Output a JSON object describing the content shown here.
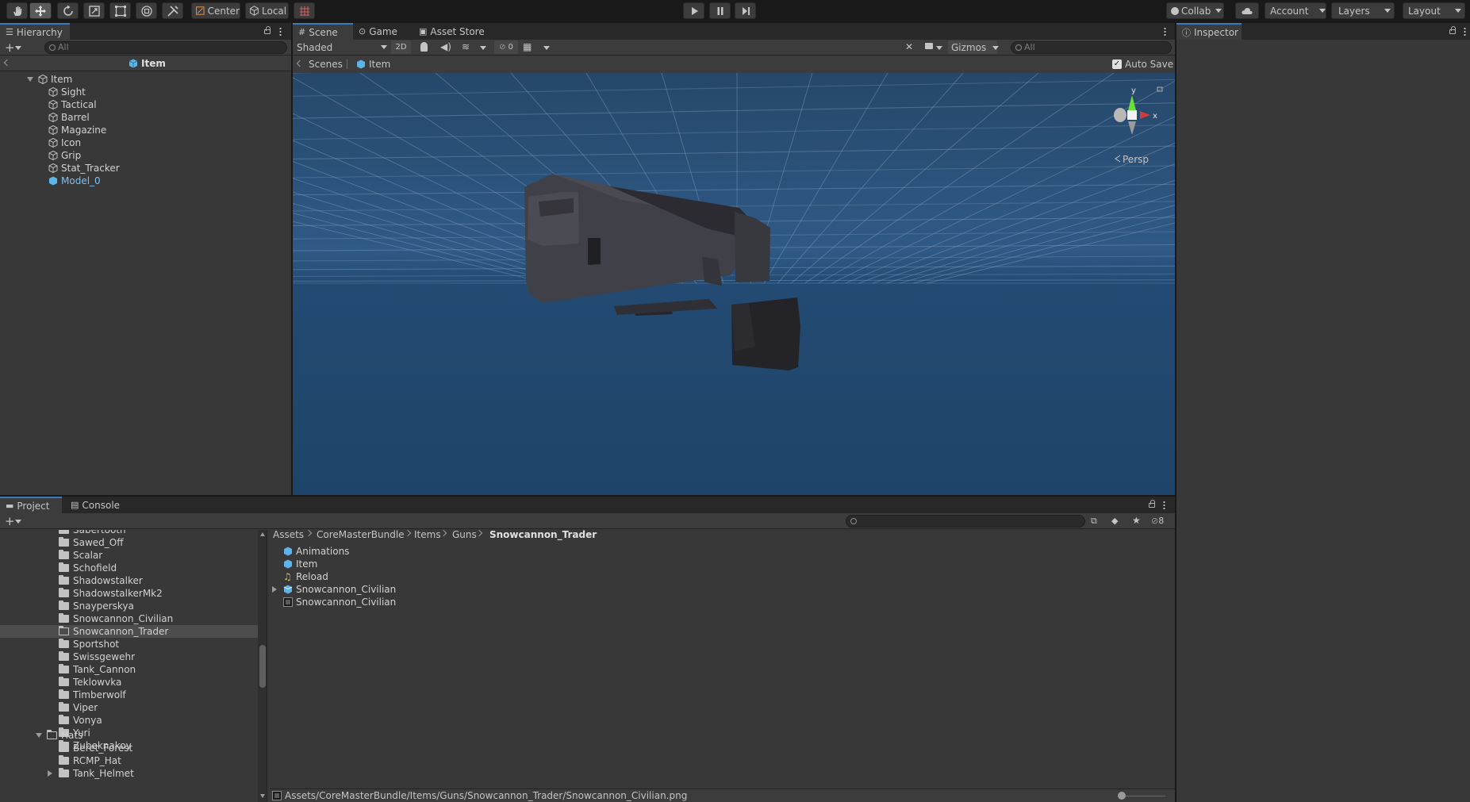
{
  "toolbar": {
    "pivot_mode": "Center",
    "pivot_rotation": "Local",
    "collab": "Collab",
    "account": "Account",
    "layers": "Layers",
    "layout": "Layout"
  },
  "hierarchy": {
    "tab": "Hierarchy",
    "search_placeholder": "All",
    "breadcrumb": "Item",
    "root": "Item",
    "children": [
      "Sight",
      "Tactical",
      "Barrel",
      "Magazine",
      "Icon",
      "Grip",
      "Stat_Tracker",
      "Model_0"
    ]
  },
  "scene": {
    "tabs": [
      "Scene",
      "Game",
      "Asset Store"
    ],
    "shading": "Shaded",
    "mode_2d": "2D",
    "hidden_count": "0",
    "gizmos": "Gizmos",
    "search_placeholder": "All",
    "breadcrumb_root": "Scenes",
    "breadcrumb_item": "Item",
    "auto_save": "Auto Save",
    "persp_label": "Persp",
    "axis_y": "y",
    "axis_x": "x"
  },
  "inspector": {
    "tab": "Inspector"
  },
  "project": {
    "tabs": [
      "Project",
      "Console"
    ],
    "hidden_count": "8",
    "folders": [
      "Sabertooth",
      "Sawed_Off",
      "Scalar",
      "Schofield",
      "Shadowstalker",
      "ShadowstalkerMk2",
      "Snayperskya",
      "Snowcannon_Civilian",
      "Snowcannon_Trader",
      "Sportshot",
      "Swissgewehr",
      "Tank_Cannon",
      "Teklowvka",
      "Timberwolf",
      "Viper",
      "Vonya",
      "Yuri",
      "Zubeknakov"
    ],
    "selected_folder": "Snowcannon_Trader",
    "hats_label": "Hats",
    "hats": [
      "Beret_Forest",
      "RCMP_Hat",
      "Tank_Helmet"
    ],
    "breadcrumb": [
      "Assets",
      "CoreMasterBundle",
      "Items",
      "Guns",
      "Snowcannon_Trader"
    ],
    "assets": [
      "Animations",
      "Item",
      "Reload",
      "Snowcannon_Civilian",
      "Snowcannon_Civilian"
    ],
    "status_path": "Assets/CoreMasterBundle/Items/Guns/Snowcannon_Trader/Snowcannon_Civilian.png"
  },
  "colors": {
    "accent": "#3a79bb",
    "panel": "#383838",
    "scene_sky": "#2a4a6e",
    "selection": "#4d4d4d"
  }
}
